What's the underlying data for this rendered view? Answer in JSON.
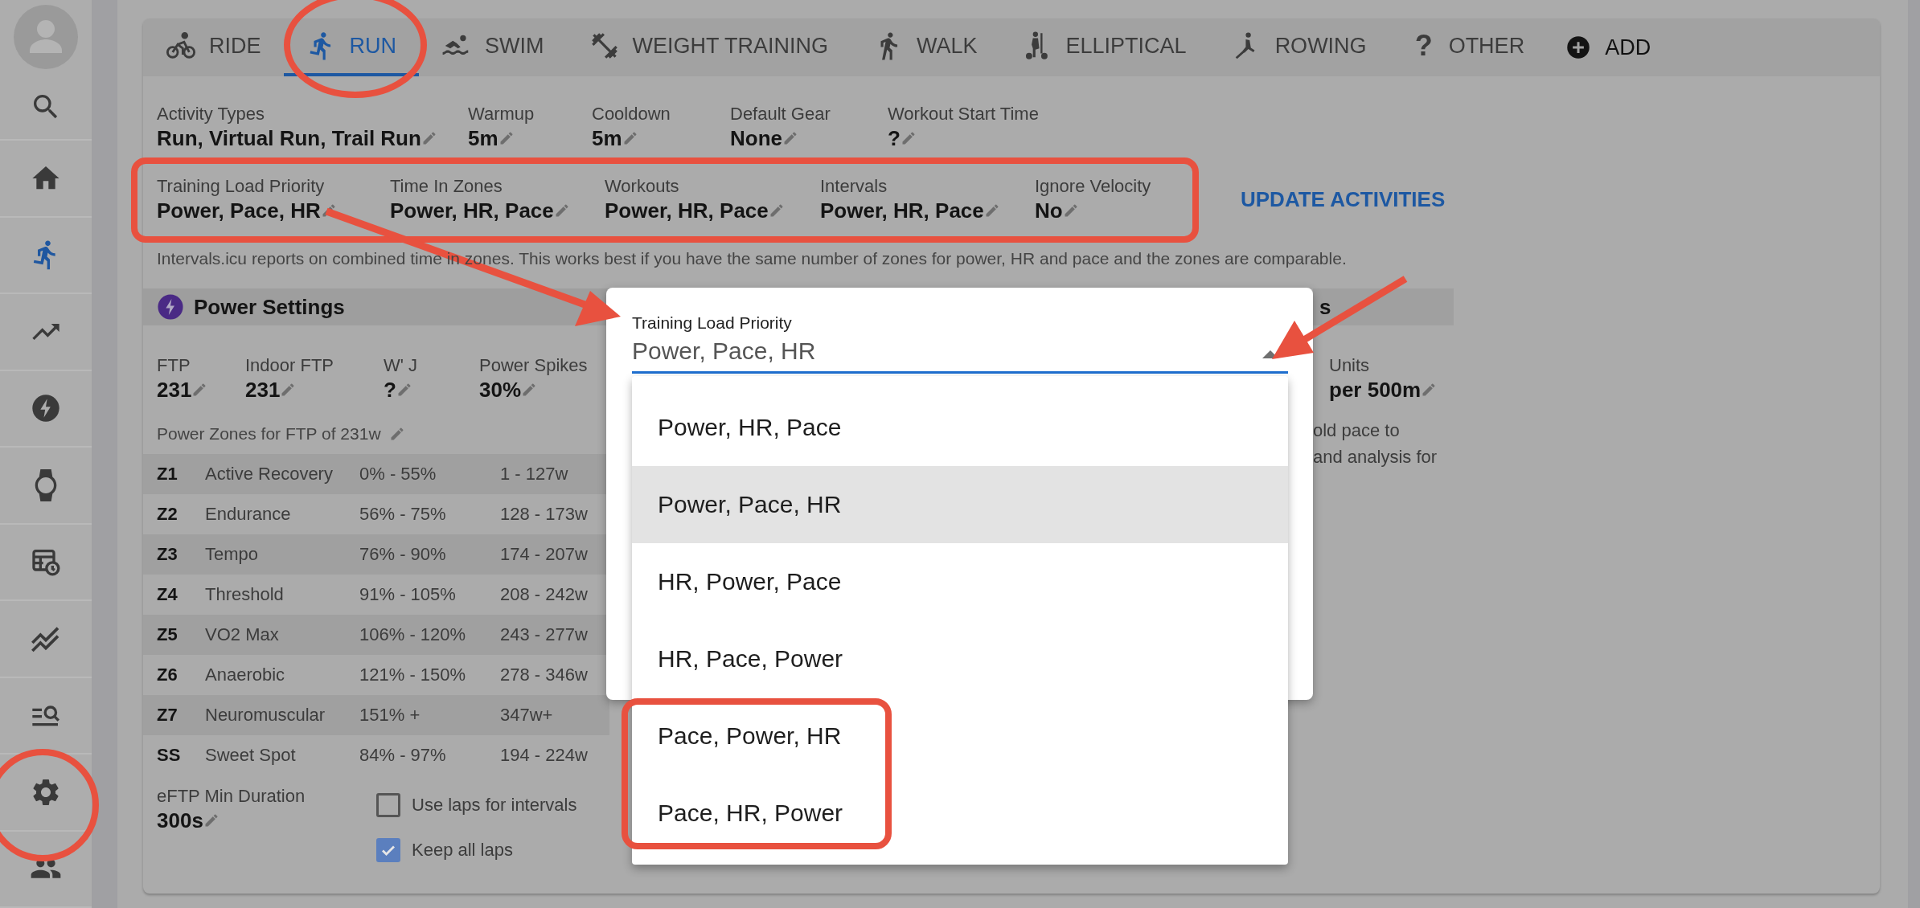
{
  "sidebar": {
    "items": [
      {
        "kind": "avatar",
        "selected": false
      },
      {
        "kind": "search",
        "selected": false
      },
      {
        "kind": "home",
        "selected": false
      },
      {
        "kind": "run",
        "selected": true
      },
      {
        "kind": "trend",
        "selected": false
      },
      {
        "kind": "bolt",
        "selected": false
      },
      {
        "kind": "watch",
        "selected": false
      },
      {
        "kind": "calendar",
        "selected": false
      },
      {
        "kind": "chart",
        "selected": false
      },
      {
        "kind": "list-search",
        "selected": false
      },
      {
        "kind": "settings",
        "selected": false
      },
      {
        "kind": "people",
        "selected": false
      }
    ]
  },
  "tabs": [
    {
      "kind": "ride",
      "label": "RIDE",
      "selected": false
    },
    {
      "kind": "run",
      "label": "RUN",
      "selected": true
    },
    {
      "kind": "swim",
      "label": "SWIM",
      "selected": false
    },
    {
      "kind": "weight",
      "label": "WEIGHT TRAINING",
      "selected": false
    },
    {
      "kind": "walk",
      "label": "WALK",
      "selected": false
    },
    {
      "kind": "elliptical",
      "label": "ELLIPTICAL",
      "selected": false
    },
    {
      "kind": "rowing",
      "label": "ROWING",
      "selected": false
    },
    {
      "kind": "other",
      "icon": "?",
      "label": "OTHER",
      "selected": false
    }
  ],
  "add_button": {
    "label": "ADD"
  },
  "fields": [
    {
      "label": "Activity Types",
      "value": "Run, Virtual Run, Trail Run"
    },
    {
      "label": "Warmup",
      "value": "5m"
    },
    {
      "label": "Cooldown",
      "value": "5m"
    },
    {
      "label": "Default Gear",
      "value": "None"
    },
    {
      "label": "Workout Start Time",
      "value": "?"
    }
  ],
  "priority_fields": [
    {
      "label": "Training Load Priority",
      "value": "Power, Pace, HR"
    },
    {
      "label": "Time In Zones",
      "value": "Power, HR, Pace"
    },
    {
      "label": "Workouts",
      "value": "Power, HR, Pace"
    },
    {
      "label": "Intervals",
      "value": "Power, HR, Pace"
    },
    {
      "label": "Ignore Velocity",
      "value": "No"
    }
  ],
  "update_button": {
    "label": "UPDATE ACTIVITIES"
  },
  "note": "Intervals.icu reports on combined time in zones. This works best if you have the same number of zones for power, HR and pace and the zones are comparable.",
  "power": {
    "title": "Power Settings",
    "fields": [
      {
        "label": "FTP",
        "value": "231"
      },
      {
        "label": "Indoor FTP",
        "value": "231"
      },
      {
        "label": "W' J",
        "value": "?"
      },
      {
        "label": "Power Spikes",
        "value": "30%"
      }
    ],
    "zones_caption": "Power Zones for FTP of 231w",
    "zones": [
      {
        "zone": "Z1",
        "name": "Active Recovery",
        "percent": "0% - 55%",
        "watts": "1 - 127w"
      },
      {
        "zone": "Z2",
        "name": "Endurance",
        "percent": "56% - 75%",
        "watts": "128 - 173w"
      },
      {
        "zone": "Z3",
        "name": "Tempo",
        "percent": "76% - 90%",
        "watts": "174 - 207w"
      },
      {
        "zone": "Z4",
        "name": "Threshold",
        "percent": "91% - 105%",
        "watts": "208 - 242w"
      },
      {
        "zone": "Z5",
        "name": "VO2 Max",
        "percent": "106% - 120%",
        "watts": "243 - 277w"
      },
      {
        "zone": "Z6",
        "name": "Anaerobic",
        "percent": "121% - 150%",
        "watts": "278 - 346w"
      },
      {
        "zone": "Z7",
        "name": "Neuromuscular",
        "percent": "151% +",
        "watts": "347w+"
      },
      {
        "zone": "SS",
        "name": "Sweet Spot",
        "percent": "84% - 97%",
        "watts": "194 - 224w"
      }
    ],
    "eftp": {
      "label": "eFTP Min Duration",
      "value": "300s"
    },
    "checkboxes": [
      {
        "label": "Use laps for intervals",
        "checked": false
      },
      {
        "label": "Keep all laps",
        "checked": true
      }
    ]
  },
  "right_panel": {
    "title": "s",
    "fields": [
      {
        "label": "Units",
        "value": "per 500m"
      }
    ],
    "text_lines": [
      "old pace to",
      "and analysis for"
    ]
  },
  "dialog": {
    "label": "Training Load Priority",
    "value": "Power, Pace, HR",
    "options": [
      {
        "label": "Power, HR, Pace",
        "selected": false
      },
      {
        "label": "Power, Pace, HR",
        "selected": true
      },
      {
        "label": "HR, Power, Pace",
        "selected": false
      },
      {
        "label": "HR, Pace, Power",
        "selected": false
      },
      {
        "label": "Pace, Power, HR",
        "selected": false
      },
      {
        "label": "Pace, HR, Power",
        "selected": false
      }
    ]
  }
}
